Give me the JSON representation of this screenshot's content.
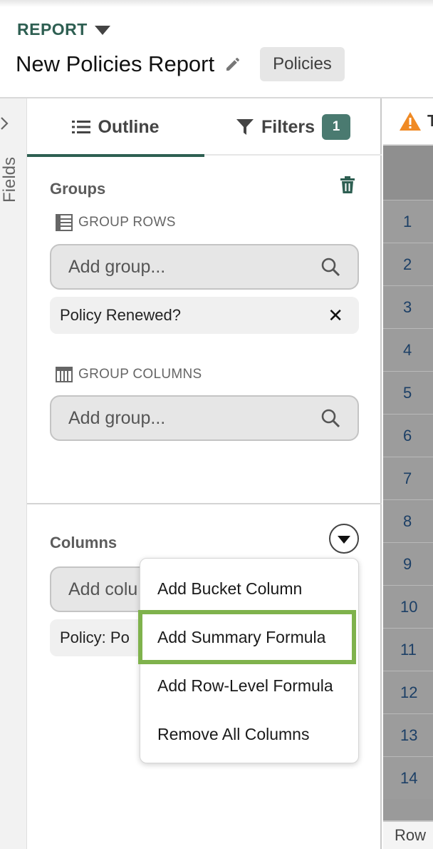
{
  "header": {
    "object_type": "REPORT",
    "title": "New Policies Report",
    "object_badge": "Policies"
  },
  "rail": {
    "label": "Fields"
  },
  "tabs": {
    "outline": "Outline",
    "filters": "Filters",
    "filters_count": "1"
  },
  "groups": {
    "title": "Groups",
    "group_rows_label": "GROUP ROWS",
    "group_rows_placeholder": "Add group...",
    "group_rows_chip": "Policy Renewed?",
    "group_columns_label": "GROUP COLUMNS",
    "group_columns_placeholder": "Add group..."
  },
  "columns": {
    "title": "Columns",
    "add_placeholder_partial": "Add colu",
    "chip_partial": "Policy: Po"
  },
  "menu": {
    "items": [
      "Add Bucket Column",
      "Add Summary Formula",
      "Add Row-Level Formula",
      "Remove All Columns"
    ],
    "highlighted_index": 1,
    "highlight_color": "#7fb24c"
  },
  "grid": {
    "top_label_partial": "T",
    "row_numbers": [
      "1",
      "2",
      "3",
      "4",
      "5",
      "6",
      "7",
      "8",
      "9",
      "10",
      "11",
      "12",
      "13",
      "14"
    ],
    "footer_partial": "Row"
  },
  "colors": {
    "brand": "#2e5f52",
    "filter_badge": "#4a7a70",
    "warning": "#f08a24"
  },
  "icons": [
    "pencil-icon",
    "list-icon",
    "filter-icon",
    "trash-icon",
    "table-rows-icon",
    "table-columns-icon",
    "search-icon",
    "close-icon",
    "chevron-right-icon",
    "dropdown-caret-icon",
    "warning-icon"
  ]
}
